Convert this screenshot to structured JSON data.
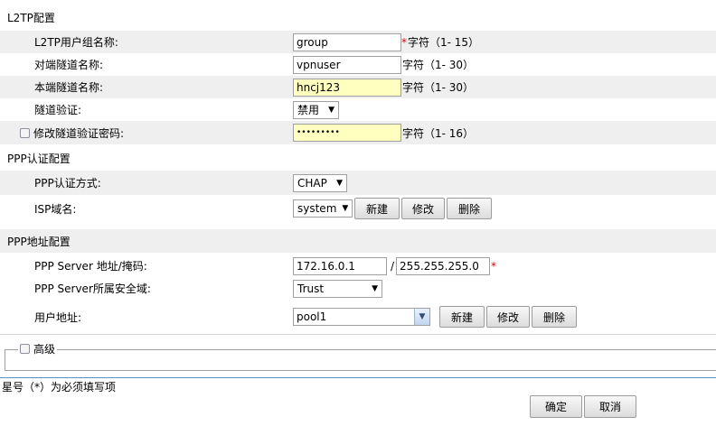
{
  "l2tp": {
    "title": "L2TP配置",
    "group_label": "L2TP用户组名称:",
    "group_value": "group",
    "group_hint": "字符（1- 15）",
    "peer_label": "对端隧道名称:",
    "peer_value": "vpnuser",
    "peer_hint": "字符（1- 30）",
    "local_label": "本端隧道名称:",
    "local_value": "hncj123",
    "local_hint": "字符（1- 30）",
    "auth_label": "隧道验证:",
    "auth_value": "禁用",
    "pwd_label": "修改隧道验证密码:",
    "pwd_value": "•••••••••",
    "pwd_hint": "字符（1- 16）"
  },
  "ppp_auth": {
    "title": "PPP认证配置",
    "method_label": "PPP认证方式:",
    "method_value": "CHAP",
    "isp_label": "ISP域名:",
    "isp_value": "system",
    "new_label": "新建",
    "edit_label": "修改",
    "delete_label": "删除"
  },
  "ppp_addr": {
    "title": "PPP地址配置",
    "server_label": "PPP Server 地址/掩码:",
    "server_ip": "172.16.0.1",
    "slash": "/",
    "server_mask": "255.255.255.0",
    "zone_label": "PPP Server所属安全域:",
    "zone_value": "Trust",
    "pool_label": "用户地址:",
    "pool_value": "pool1",
    "new_label": "新建",
    "edit_label": "修改",
    "delete_label": "删除"
  },
  "advanced": {
    "label": "高级"
  },
  "footer": {
    "note": "星号（*）为必须填写项",
    "ok_label": "确定",
    "cancel_label": "取消"
  },
  "required_mark": "*",
  "icons": {
    "dropdown": "triangle-down",
    "checkbox": "checkbox"
  },
  "colors": {
    "row_shade": "#efefef",
    "input_highlight": "#ffffc0",
    "required": "#e00000",
    "divider": "#5a8fc8"
  }
}
